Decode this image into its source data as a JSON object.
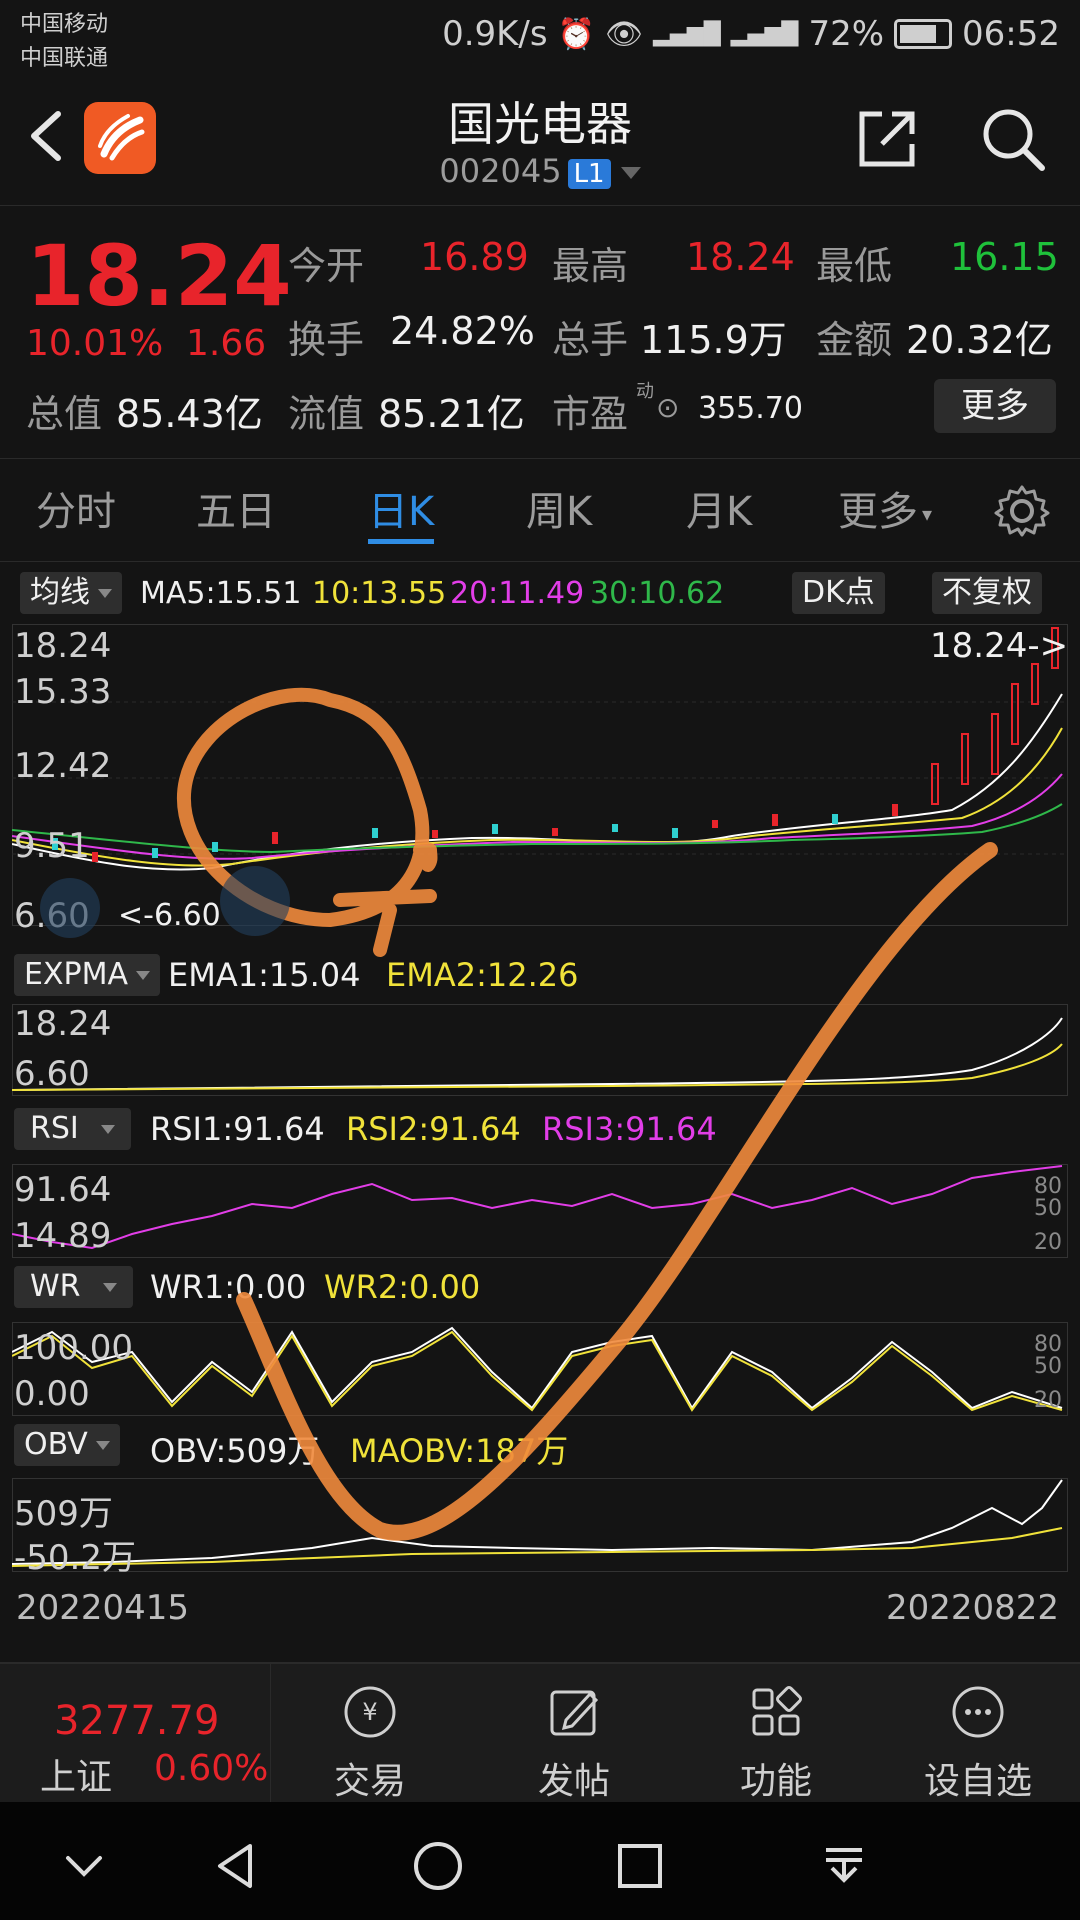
{
  "status_bar": {
    "carrier1": "中国移动",
    "carrier2": "中国联通",
    "net_speed": "0.9K/s",
    "battery": "72%",
    "time": "06:52"
  },
  "header": {
    "stock_name": "国光电器",
    "stock_code": "002045",
    "level_badge": "L1"
  },
  "quote": {
    "price": "18.24",
    "change_pct": "10.01%",
    "change_amt": "1.66",
    "open_label": "今开",
    "open_value": "16.89",
    "high_label": "最高",
    "high_value": "18.24",
    "low_label": "最低",
    "low_value": "16.15",
    "turnover_label": "换手",
    "turnover_value": "24.82%",
    "volume_label": "总手",
    "volume_value": "115.9万",
    "amount_label": "金额",
    "amount_value": "20.32亿",
    "mktcap_label": "总值",
    "mktcap_value": "85.43亿",
    "float_label": "流值",
    "float_value": "85.21亿",
    "pe_label": "市盈",
    "pe_sup": "动",
    "pe_value": "355.70",
    "more_label": "更多"
  },
  "tabs": {
    "t1": "分时",
    "t2": "五日",
    "t3": "日K",
    "t4": "周K",
    "t5": "月K",
    "t6": "更多"
  },
  "ma_panel": {
    "selector": "均线",
    "ma5": "MA5:15.51",
    "ma10": "10:13.55",
    "ma20": "20:11.49",
    "ma30": "30:10.62",
    "dk_btn": "DK点",
    "adjust_btn": "不复权",
    "y_top": "18.24",
    "y_2": "15.33",
    "y_3": "12.42",
    "y_4": "9.51",
    "y_bottom": "6.60",
    "last_marker": "18.24->",
    "low_marker": "<-6.60"
  },
  "expma_panel": {
    "selector": "EXPMA",
    "ema1": "EMA1:15.04",
    "ema2": "EMA2:12.26",
    "y_top": "18.24",
    "y_bottom": "6.60"
  },
  "rsi_panel": {
    "selector": "RSI",
    "rsi1": "RSI1:91.64",
    "rsi2": "RSI2:91.64",
    "rsi3": "RSI3:91.64",
    "y_top": "91.64",
    "y_bottom": "14.89",
    "ref_80": "80",
    "ref_50": "50",
    "ref_20": "20"
  },
  "wr_panel": {
    "selector": "WR",
    "wr1": "WR1:0.00",
    "wr2": "WR2:0.00",
    "y_top": "100.00",
    "y_bottom": "0.00",
    "ref_80": "80",
    "ref_50": "50",
    "ref_20": "20"
  },
  "obv_panel": {
    "selector": "OBV",
    "obv": "OBV:509万",
    "maobv": "MAOBV:187万",
    "y_top": "509万",
    "y_bottom": "-50.2万"
  },
  "date_range": {
    "start": "20220415",
    "end": "20220822"
  },
  "bottom_nav": {
    "index_value": "3277.79",
    "index_name": "上证",
    "index_change": "0.60%",
    "trade": "交易",
    "post": "发帖",
    "functions": "功能",
    "watchlist": "设自选"
  },
  "colors": {
    "up": "#e8242b",
    "down": "#1fc13b",
    "accent": "#2f8de4",
    "ma5": "#ffffff",
    "ma10": "#f0e23a",
    "ma20": "#e23ee8",
    "ma30": "#2fb84a",
    "annotation": "#f08a3c"
  }
}
